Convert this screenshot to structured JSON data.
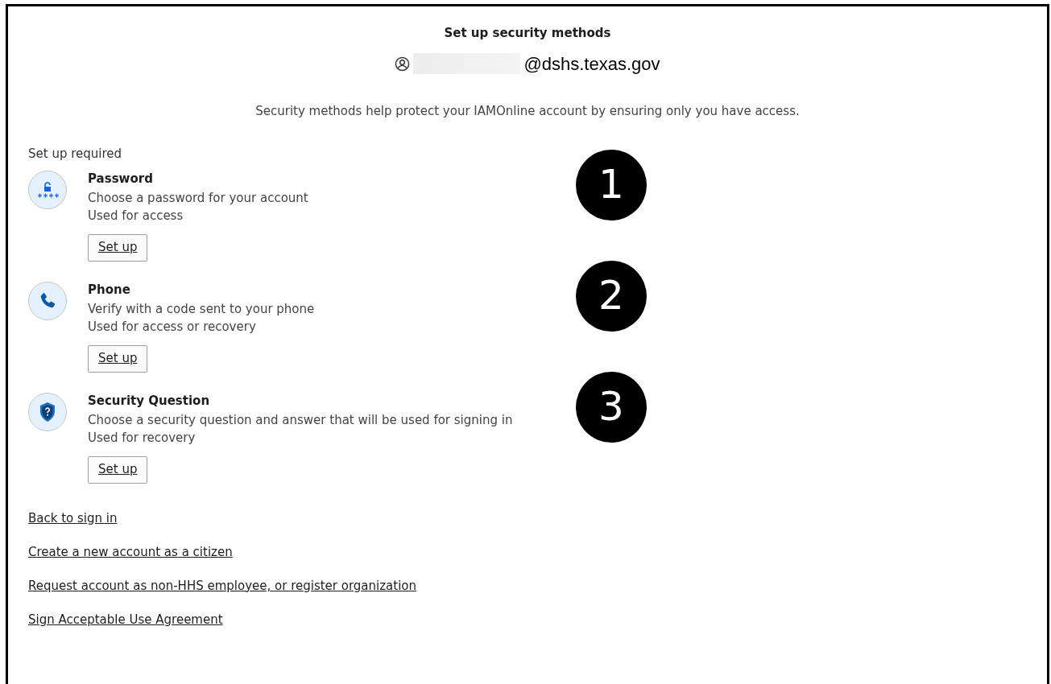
{
  "heading": "Set up security methods",
  "account": {
    "email_suffix": "@dshs.texas.gov"
  },
  "intro": "Security methods help protect your IAMOnline account by ensuring only you have access.",
  "section_label": "Set up required",
  "methods": [
    {
      "kind": "password",
      "title": "Password",
      "description": "Choose a password for your account",
      "usage": "Used for access",
      "button": "Set up",
      "step": "1"
    },
    {
      "kind": "phone",
      "title": "Phone",
      "description": "Verify with a code sent to your phone",
      "usage": "Used for access or recovery",
      "button": "Set up",
      "step": "2"
    },
    {
      "kind": "question",
      "title": "Security Question",
      "description": "Choose a security question and answer that will be used for signing in",
      "usage": "Used for recovery",
      "button": "Set up",
      "step": "3"
    }
  ],
  "links": [
    "Back to sign in",
    "Create a new account as a citizen",
    "Request account as non-HHS employee, or register organization",
    "Sign Acceptable Use Agreement"
  ]
}
